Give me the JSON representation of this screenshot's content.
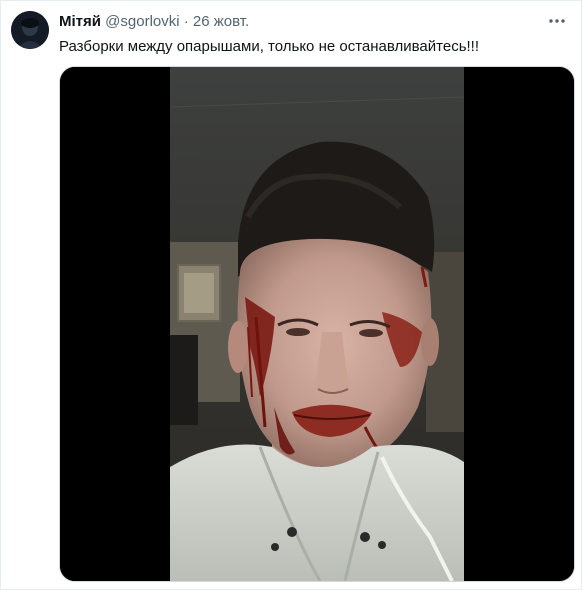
{
  "author": {
    "display_name": "Мітяй",
    "handle": "@sgorlovki",
    "separator": "·",
    "date": "26 жовт."
  },
  "tweet": {
    "text": "Разборки между опарышами, только не останавливайтесь!!!"
  },
  "icons": {
    "more": "more-horizontal-icon",
    "avatar": "avatar-image"
  },
  "colors": {
    "name": "#0f1419",
    "secondary": "#536471",
    "media_bg": "#000000"
  }
}
